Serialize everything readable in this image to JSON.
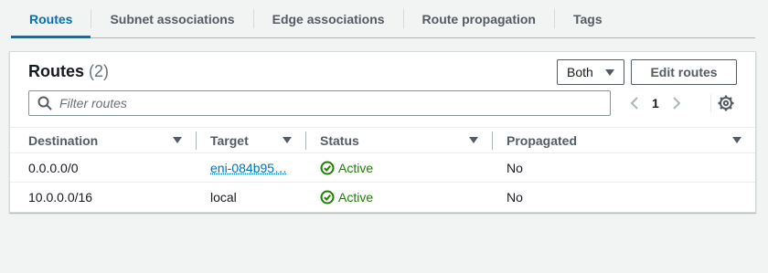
{
  "tabs": [
    {
      "label": "Routes",
      "active": true
    },
    {
      "label": "Subnet associations",
      "active": false
    },
    {
      "label": "Edge associations",
      "active": false
    },
    {
      "label": "Route propagation",
      "active": false
    },
    {
      "label": "Tags",
      "active": false
    }
  ],
  "panel": {
    "title": "Routes",
    "count": "(2)",
    "filter_select": "Both",
    "edit_button": "Edit routes",
    "filter_placeholder": "Filter routes",
    "page_number": "1"
  },
  "table": {
    "columns": [
      "Destination",
      "Target",
      "Status",
      "Propagated"
    ],
    "rows": [
      {
        "destination": "0.0.0.0/0",
        "target": "eni-084b95…",
        "target_is_link": true,
        "status": "Active",
        "propagated": "No"
      },
      {
        "destination": "10.0.0.0/16",
        "target": "local",
        "target_is_link": false,
        "status": "Active",
        "propagated": "No"
      }
    ]
  },
  "colors": {
    "accent": "#0073bb",
    "success": "#1d8102",
    "background": "#f2f3f3"
  },
  "icons": [
    "search-icon",
    "chevron-left-icon",
    "chevron-right-icon",
    "settings-gear-icon",
    "status-success-icon",
    "caret-down-icon",
    "sort-icon"
  ]
}
